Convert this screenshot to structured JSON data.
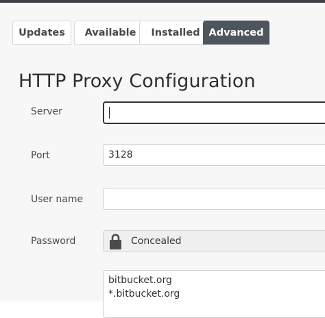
{
  "tabs": [
    {
      "label": "Updates",
      "active": false
    },
    {
      "label": "Available",
      "active": false
    },
    {
      "label": "Installed",
      "active": false
    },
    {
      "label": "Advanced",
      "active": true
    }
  ],
  "heading": "HTTP Proxy Configuration",
  "form": {
    "server": {
      "label": "Server",
      "value": ""
    },
    "port": {
      "label": "Port",
      "value": "3128"
    },
    "username": {
      "label": "User name",
      "value": ""
    },
    "password": {
      "label": "Password",
      "value": "Concealed",
      "icon": "lock-icon"
    },
    "no_proxy_hosts": [
      "bitbucket.org",
      "*.bitbucket.org"
    ]
  },
  "colors": {
    "active_tab": "#4f555c",
    "topbar": "#3b3f45",
    "background": "#f7f7f7"
  }
}
